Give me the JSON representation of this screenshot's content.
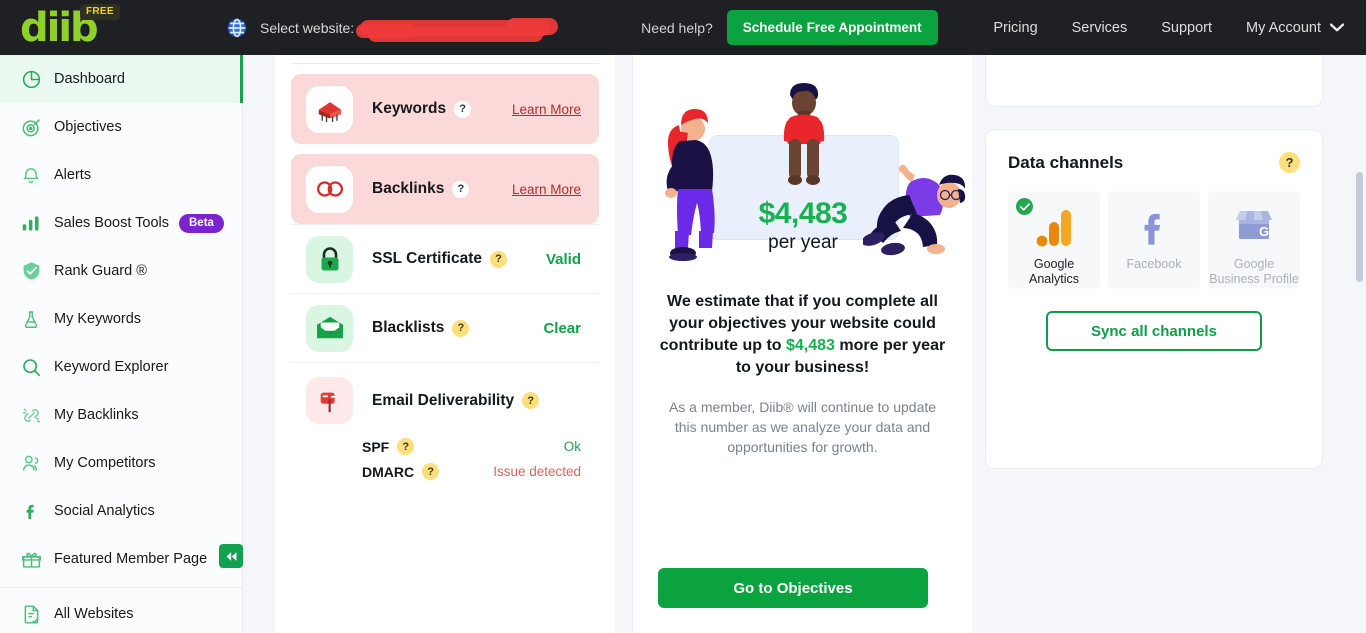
{
  "topnav": {
    "logo_text": "diib",
    "logo_badge": "FREE",
    "globe_icon": "globe-icon",
    "select_website_label": "Select website:",
    "selected_website_redacted": "",
    "need_help_label": "Need help?",
    "schedule_button": "Schedule Free Appointment",
    "links": [
      {
        "label": "Pricing"
      },
      {
        "label": "Services"
      },
      {
        "label": "Support"
      },
      {
        "label": "My Account"
      }
    ]
  },
  "sidebar": {
    "items": [
      {
        "label": "Dashboard",
        "icon": "pie-chart-icon",
        "active": true
      },
      {
        "label": "Objectives",
        "icon": "target-icon",
        "active": false
      },
      {
        "label": "Alerts",
        "icon": "bell-icon",
        "active": false
      },
      {
        "label": "Sales Boost Tools",
        "icon": "bar-chart-icon",
        "active": false,
        "badge": "Beta"
      },
      {
        "label": "Rank Guard ®",
        "icon": "shield-check-icon",
        "active": false
      },
      {
        "label": "My Keywords",
        "icon": "flask-icon",
        "active": false
      },
      {
        "label": "Keyword Explorer",
        "icon": "search-icon",
        "active": false
      },
      {
        "label": "My Backlinks",
        "icon": "link-sparkle-icon",
        "active": false
      },
      {
        "label": "My Competitors",
        "icon": "people-icon",
        "active": false
      },
      {
        "label": "Social Analytics",
        "icon": "facebook-icon",
        "active": false
      },
      {
        "label": "Featured Member Page",
        "icon": "gift-icon",
        "active": false
      },
      {
        "label": "All Websites",
        "icon": "document-check-icon",
        "active": false
      }
    ],
    "collapse_button": "◀◀"
  },
  "health_cards": [
    {
      "title": "Keywords",
      "icon": "keywords-icon",
      "state": "alert",
      "action": "Learn More"
    },
    {
      "title": "Backlinks",
      "icon": "backlinks-icon",
      "state": "alert",
      "action": "Learn More"
    },
    {
      "title": "SSL Certificate",
      "icon": "lock-icon",
      "state": "ok",
      "status": "Valid"
    },
    {
      "title": "Blacklists",
      "icon": "envelope-icon",
      "state": "ok",
      "status": "Clear"
    }
  ],
  "email_deliverability": {
    "title": "Email Deliverability",
    "icon": "mailbox-icon",
    "rows": [
      {
        "key": "SPF",
        "value": "Ok",
        "state": "ok"
      },
      {
        "key": "DMARC",
        "value": "Issue detected",
        "state": "bad"
      }
    ]
  },
  "estimate": {
    "amount": "$4,483",
    "period": "per year",
    "headline_part1": "We estimate that if you complete all your objectives your website could contribute up to ",
    "headline_amount": "$4,483",
    "headline_part2": " more per year to your business!",
    "subtext": "As a member, Diib® will continue to update this number as we analyze your data and opportunities for growth.",
    "cta_button": "Go to Objectives"
  },
  "data_channels": {
    "title": "Data channels",
    "help_icon": "question-mark-icon",
    "channels": [
      {
        "label": "Google Analytics",
        "icon": "google-analytics-icon",
        "connected": true
      },
      {
        "label": "Facebook",
        "icon": "facebook-icon",
        "connected": false
      },
      {
        "label": "Google Business Profile",
        "icon": "google-business-profile-icon",
        "connected": false
      }
    ],
    "sync_button": "Sync all channels"
  },
  "colors": {
    "brand_green": "#0aa33f",
    "logo_green": "#8ed12a",
    "alert_pink": "#fbd9d9",
    "alert_red_text": "#b32b2b",
    "nav_dark": "#1f2023",
    "beta_purple": "#7b23cf",
    "yellow_help": "#fbdf7a"
  }
}
